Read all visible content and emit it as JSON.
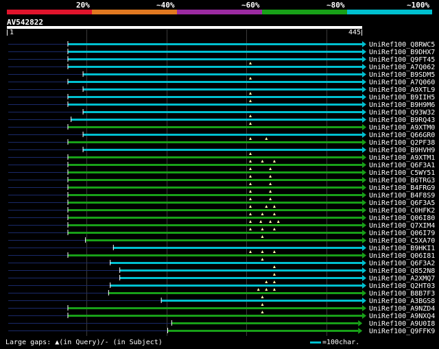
{
  "legend": {
    "segments": [
      {
        "label": "20%",
        "color": "#e0142c"
      },
      {
        "label": "~40%",
        "color": "#e07820"
      },
      {
        "label": "~60%",
        "color": "#9a2aa0"
      },
      {
        "label": "~80%",
        "color": "#18a018"
      },
      {
        "label": "~100%",
        "color": "#00c0d0"
      }
    ]
  },
  "query": {
    "name": "AV542822",
    "start": "1",
    "end": "445"
  },
  "footer": {
    "gaps_text": "Large gaps: ▲(in Query)/- (in Subject)",
    "scale_text": "=100char."
  },
  "chart_data": {
    "type": "alignment",
    "query_length": 445,
    "hits": [
      {
        "name": "UniRef100_Q8RWC5",
        "start": 76,
        "end": 445,
        "identity": "~100%",
        "color": "#00c0d0",
        "gaps": []
      },
      {
        "name": "UniRef100_B9DHX7",
        "start": 76,
        "end": 445,
        "identity": "~100%",
        "color": "#00c0d0",
        "gaps": []
      },
      {
        "name": "UniRef100_Q9FT45",
        "start": 76,
        "end": 445,
        "identity": "~100%",
        "color": "#00c0d0",
        "gaps": []
      },
      {
        "name": "UniRef100_A7Q062",
        "start": 76,
        "end": 445,
        "identity": "~100%",
        "color": "#00c0d0",
        "gaps": [
          305
        ]
      },
      {
        "name": "UniRef100_B9SDM5",
        "start": 95,
        "end": 445,
        "identity": "~100%",
        "color": "#00c0d0",
        "gaps": []
      },
      {
        "name": "UniRef100_A7Q060",
        "start": 76,
        "end": 445,
        "identity": "~100%",
        "color": "#00c0d0",
        "gaps": [
          305
        ]
      },
      {
        "name": "UniRef100_A9XTL9",
        "start": 95,
        "end": 445,
        "identity": "~100%",
        "color": "#00c0d0",
        "gaps": []
      },
      {
        "name": "UniRef100_B9IIH5",
        "start": 76,
        "end": 445,
        "identity": "~100%",
        "color": "#00c0d0",
        "gaps": [
          305
        ]
      },
      {
        "name": "UniRef100_B9H9M6",
        "start": 76,
        "end": 445,
        "identity": "~100%",
        "color": "#00c0d0",
        "gaps": [
          305
        ]
      },
      {
        "name": "UniRef100_Q93W32",
        "start": 95,
        "end": 445,
        "identity": "~100%",
        "color": "#00c0d0",
        "gaps": []
      },
      {
        "name": "UniRef100_B9RQ43",
        "start": 80,
        "end": 445,
        "identity": "~100%",
        "color": "#00c0d0",
        "gaps": [
          305
        ]
      },
      {
        "name": "UniRef100_A9XTM0",
        "start": 76,
        "end": 445,
        "identity": "~80%",
        "color": "#18a018",
        "gaps": [
          305
        ]
      },
      {
        "name": "UniRef100_Q66GR0",
        "start": 95,
        "end": 445,
        "identity": "~100%",
        "color": "#00c0d0",
        "gaps": []
      },
      {
        "name": "UniRef100_Q2PF38",
        "start": 76,
        "end": 445,
        "identity": "~80%",
        "color": "#18a018",
        "gaps": [
          305,
          325
        ]
      },
      {
        "name": "UniRef100_B9HVH9",
        "start": 95,
        "end": 445,
        "identity": "~100%",
        "color": "#00c0d0",
        "gaps": []
      },
      {
        "name": "UniRef100_A9XTM1",
        "start": 76,
        "end": 445,
        "identity": "~80%",
        "color": "#18a018",
        "gaps": [
          305
        ]
      },
      {
        "name": "UniRef100_Q6F3A1",
        "start": 76,
        "end": 445,
        "identity": "~80%",
        "color": "#18a018",
        "gaps": [
          305,
          320,
          335
        ]
      },
      {
        "name": "UniRef100_C5WY51",
        "start": 76,
        "end": 445,
        "identity": "~80%",
        "color": "#18a018",
        "gaps": [
          305,
          330
        ]
      },
      {
        "name": "UniRef100_B6TRG3",
        "start": 76,
        "end": 445,
        "identity": "~80%",
        "color": "#18a018",
        "gaps": [
          305,
          330
        ]
      },
      {
        "name": "UniRef100_B4FRG9",
        "start": 76,
        "end": 445,
        "identity": "~80%",
        "color": "#18a018",
        "gaps": [
          305,
          330
        ]
      },
      {
        "name": "UniRef100_B4F8S9",
        "start": 76,
        "end": 445,
        "identity": "~80%",
        "color": "#18a018",
        "gaps": [
          305,
          330
        ]
      },
      {
        "name": "UniRef100_Q6F3A5",
        "start": 76,
        "end": 445,
        "identity": "~80%",
        "color": "#18a018",
        "gaps": [
          305,
          330
        ]
      },
      {
        "name": "UniRef100_C0HFK2",
        "start": 76,
        "end": 445,
        "identity": "~80%",
        "color": "#18a018",
        "gaps": [
          305,
          325,
          335
        ]
      },
      {
        "name": "UniRef100_Q06I80",
        "start": 76,
        "end": 445,
        "identity": "~80%",
        "color": "#18a018",
        "gaps": [
          305,
          320,
          335
        ]
      },
      {
        "name": "UniRef100_Q7XIM4",
        "start": 76,
        "end": 445,
        "identity": "~80%",
        "color": "#18a018",
        "gaps": [
          305,
          318,
          330,
          340
        ]
      },
      {
        "name": "UniRef100_Q06I79",
        "start": 76,
        "end": 445,
        "identity": "~80%",
        "color": "#18a018",
        "gaps": [
          305,
          320,
          335
        ]
      },
      {
        "name": "UniRef100_C5XA70",
        "start": 98,
        "end": 445,
        "identity": "~80%",
        "color": "#18a018",
        "gaps": [
          320
        ]
      },
      {
        "name": "UniRef100_B9HKI1",
        "start": 133,
        "end": 445,
        "identity": "~100%",
        "color": "#00c0d0",
        "gaps": []
      },
      {
        "name": "UniRef100_Q06I81",
        "start": 76,
        "end": 445,
        "identity": "~80%",
        "color": "#18a018",
        "gaps": [
          305,
          320,
          335
        ]
      },
      {
        "name": "UniRef100_Q6F3A2",
        "start": 129,
        "end": 445,
        "identity": "~100%",
        "color": "#00c0d0",
        "gaps": [
          320
        ]
      },
      {
        "name": "UniRef100_Q852N8",
        "start": 141,
        "end": 445,
        "identity": "~100%",
        "color": "#00c0d0",
        "gaps": [
          335
        ]
      },
      {
        "name": "UniRef100_A2XMQ7",
        "start": 141,
        "end": 445,
        "identity": "~100%",
        "color": "#00c0d0",
        "gaps": [
          335
        ]
      },
      {
        "name": "UniRef100_Q2HT03",
        "start": 129,
        "end": 445,
        "identity": "~100%",
        "color": "#00c0d0",
        "gaps": [
          325,
          335
        ]
      },
      {
        "name": "UniRef100_B8B7F3",
        "start": 127,
        "end": 445,
        "identity": "~80%",
        "color": "#18a018",
        "gaps": [
          315,
          325,
          335
        ]
      },
      {
        "name": "UniRef100_A3BGS8",
        "start": 193,
        "end": 445,
        "identity": "~100%",
        "color": "#00c0d0",
        "gaps": [
          320
        ]
      },
      {
        "name": "UniRef100_A9NZD4",
        "start": 76,
        "end": 445,
        "identity": "~80%",
        "color": "#18a018",
        "gaps": [
          320
        ]
      },
      {
        "name": "UniRef100_A9NXQ4",
        "start": 76,
        "end": 445,
        "identity": "~80%",
        "color": "#18a018",
        "gaps": [
          320
        ]
      },
      {
        "name": "UniRef100_A9U0I8",
        "start": 206,
        "end": 440,
        "identity": "~80%",
        "color": "#18a018",
        "gaps": []
      },
      {
        "name": "UniRef100_Q9FFK9",
        "start": 201,
        "end": 440,
        "identity": "~80%",
        "color": "#18a018",
        "gaps": []
      }
    ]
  }
}
